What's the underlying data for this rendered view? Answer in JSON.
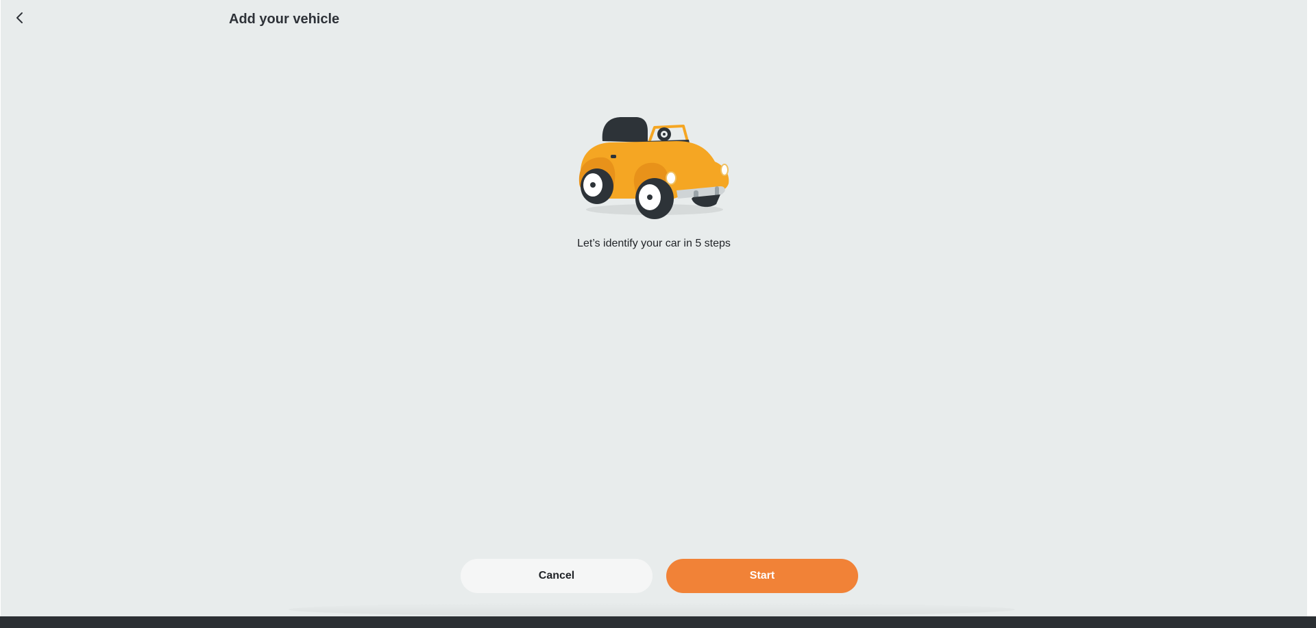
{
  "header": {
    "back_icon": "chevron-left-icon",
    "title": "Add your vehicle"
  },
  "main": {
    "illustration": "yellow-car-illustration",
    "intro_text": "Let’s identify your car in 5 steps"
  },
  "actions": {
    "cancel_label": "Cancel",
    "start_label": "Start"
  },
  "colors": {
    "background": "#e8ecec",
    "accent": "#f18237",
    "car_body": "#f5a623",
    "taskbar": "#2b2f33"
  }
}
